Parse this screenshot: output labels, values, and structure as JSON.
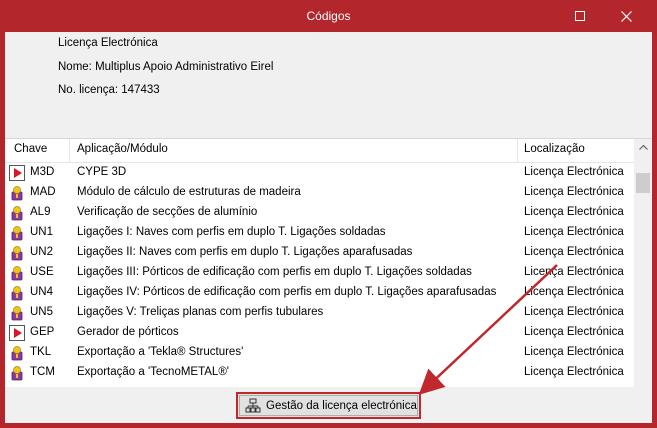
{
  "window": {
    "title": "Códigos",
    "controls": {
      "maximize_icon": "maximize-icon",
      "close_glyph": "✕"
    },
    "accent_color": "#b3262c"
  },
  "info": {
    "license_type": "Licença Electrónica",
    "name_line": "Nome: Multiplus Apoio Administrativo Eirel",
    "license_number_line": "No. licença: 147433"
  },
  "table": {
    "columns": [
      "Chave",
      "Aplicação/Módulo",
      "Localização"
    ],
    "rows": [
      {
        "icon": "play-icon",
        "code": "M3D",
        "app": "CYPE 3D",
        "location": "Licença Electrónica"
      },
      {
        "icon": "key-icon",
        "code": "MAD",
        "app": "Módulo de cálculo de estruturas de madeira",
        "location": "Licença Electrónica"
      },
      {
        "icon": "key-icon",
        "code": "AL9",
        "app": "Verificação de secções de alumínio",
        "location": "Licença Electrónica"
      },
      {
        "icon": "key-icon",
        "code": "UN1",
        "app": "Ligações I: Naves com perfis em duplo T. Ligações soldadas",
        "location": "Licença Electrónica"
      },
      {
        "icon": "key-icon",
        "code": "UN2",
        "app": "Ligações II: Naves com perfis em duplo T. Ligações aparafusadas",
        "location": "Licença Electrónica"
      },
      {
        "icon": "key-icon",
        "code": "USE",
        "app": "Ligações III: Pórticos de edificação com perfis em duplo T. Ligações soldadas",
        "location": "Licença Electrónica"
      },
      {
        "icon": "key-icon",
        "code": "UN4",
        "app": "Ligações IV: Pórticos de edificação com perfis em duplo T. Ligações aparafusadas",
        "location": "Licença Electrónica"
      },
      {
        "icon": "key-icon",
        "code": "UN5",
        "app": "Ligações V: Treliças planas com perfis tubulares",
        "location": "Licença Electrónica"
      },
      {
        "icon": "play-icon",
        "code": "GEP",
        "app": "Gerador de pórticos",
        "location": "Licença Electrónica"
      },
      {
        "icon": "key-icon",
        "code": "TKL",
        "app": "Exportação a 'Tekla® Structures'",
        "location": "Licença Electrónica"
      },
      {
        "icon": "key-icon",
        "code": "TCM",
        "app": "Exportação a 'TecnoMETAL®'",
        "location": "Licença Electrónica"
      }
    ]
  },
  "footer": {
    "license_button_label": "Gestão da licença electrónica",
    "license_button_icon": "network-icon"
  },
  "annotation": {
    "arrow_color": "#c0282d"
  }
}
